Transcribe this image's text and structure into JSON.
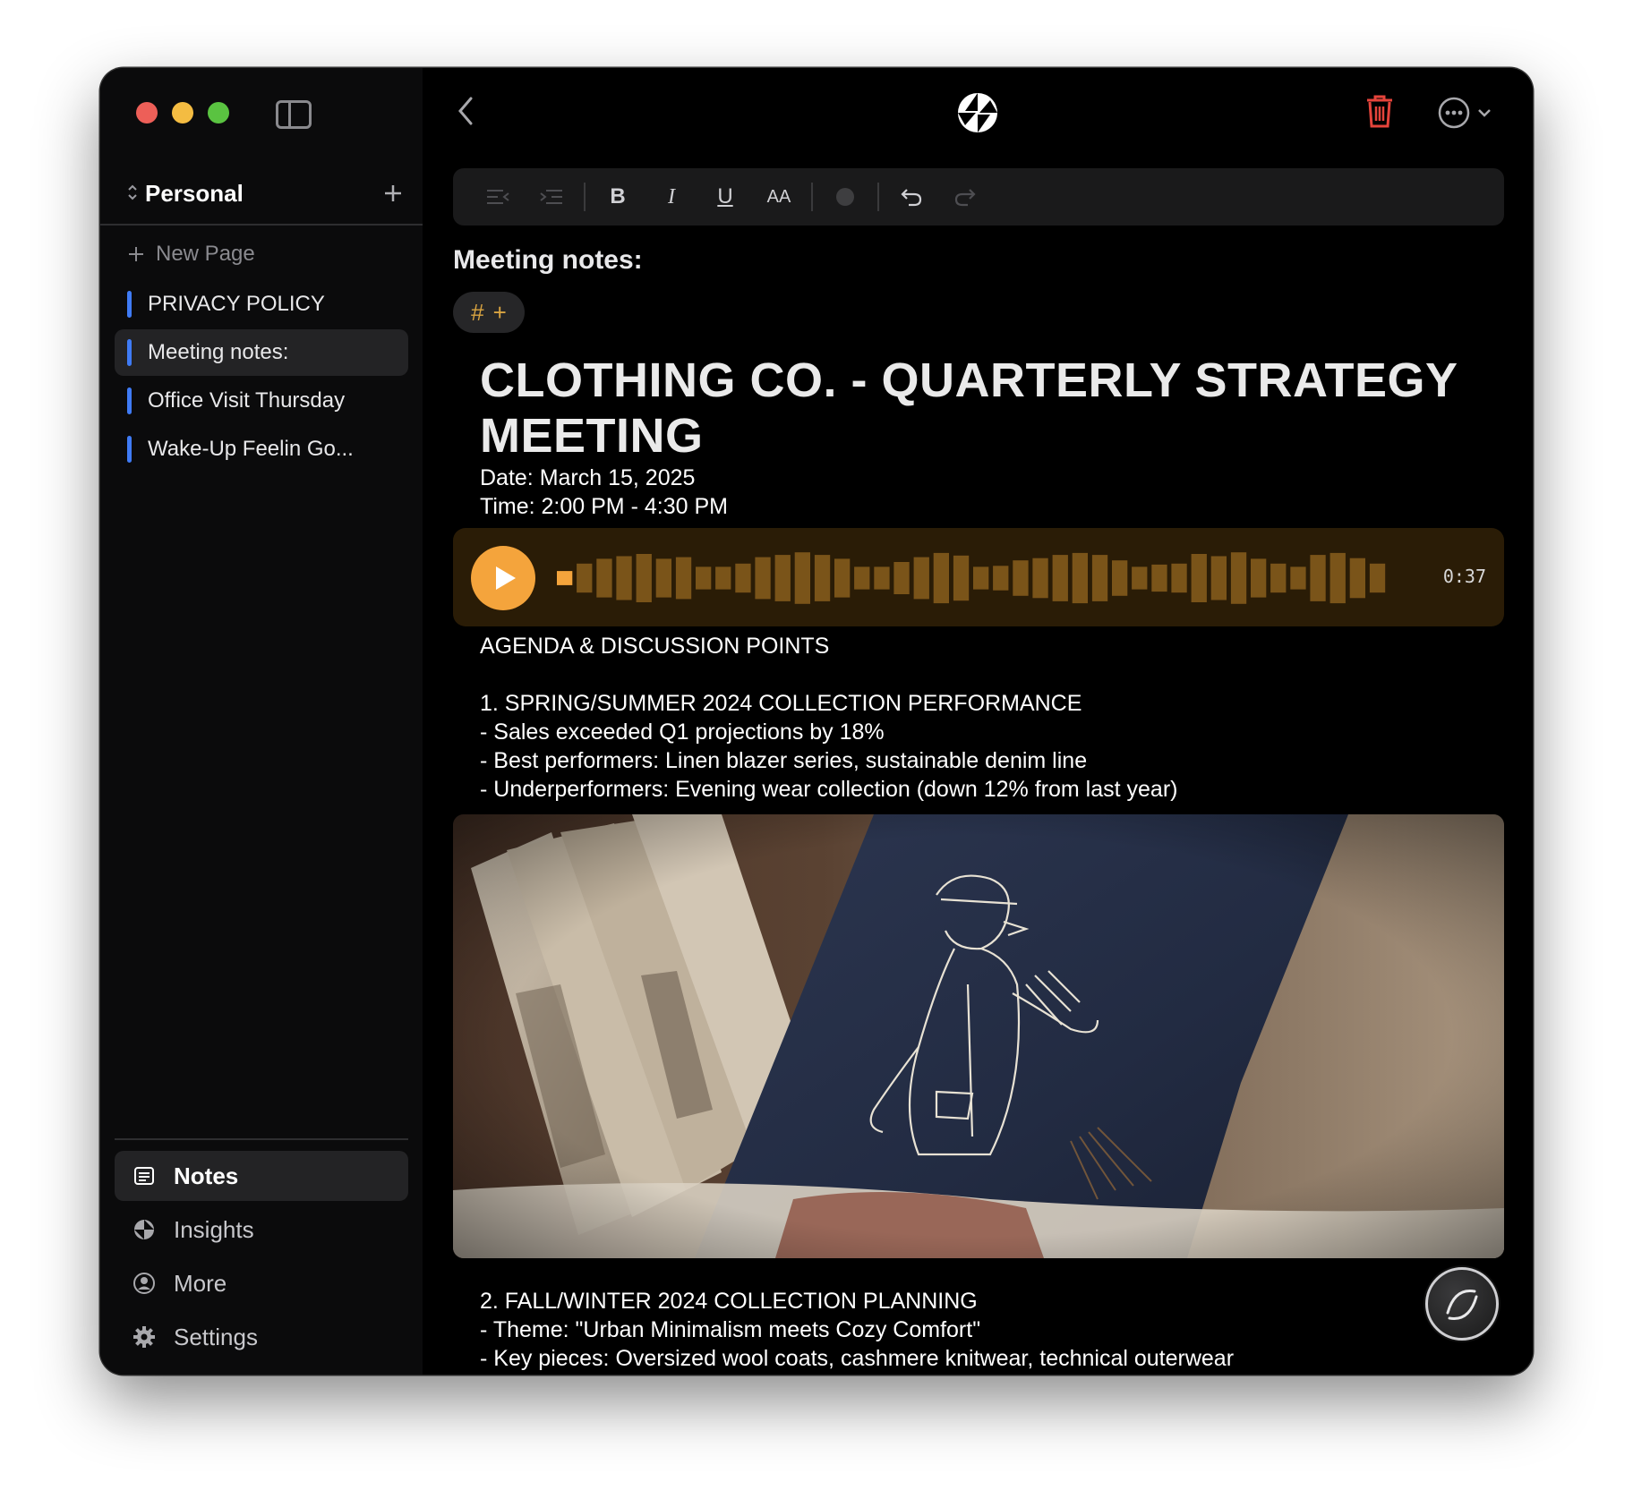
{
  "sidebar": {
    "workspace": "Personal",
    "new_page": "New Page",
    "pages": [
      {
        "label": "PRIVACY POLICY"
      },
      {
        "label": "Meeting notes:"
      },
      {
        "label": "Office Visit Thursday"
      },
      {
        "label": "Wake-Up Feelin Go..."
      }
    ],
    "nav": [
      {
        "label": "Notes",
        "icon": "notes-icon"
      },
      {
        "label": "Insights",
        "icon": "insights-icon"
      },
      {
        "label": "More",
        "icon": "person-icon"
      },
      {
        "label": "Settings",
        "icon": "gear-icon"
      }
    ]
  },
  "toolbar": {
    "bold": "B",
    "italic": "I",
    "underline": "U",
    "text_size": "AA"
  },
  "note": {
    "title": "Meeting notes:",
    "tag_hash": "#",
    "tag_add": "+",
    "heading": "CLOTHING CO. - QUARTERLY STRATEGY MEETING",
    "date": "Date: March 15, 2025",
    "time": "Time: 2:00 PM - 4:30 PM",
    "audio_duration": "0:37",
    "agenda_title": "AGENDA & DISCUSSION POINTS",
    "section1_title": "1. SPRING/SUMMER 2024 COLLECTION PERFORMANCE",
    "section1_lines": [
      "- Sales exceeded Q1 projections by 18%",
      "- Best performers: Linen blazer series, sustainable denim line",
      "- Underperformers: Evening wear collection (down 12% from last year)"
    ],
    "section2_title": "2. FALL/WINTER 2024 COLLECTION PLANNING",
    "section2_lines": [
      "- Theme: \"Urban Minimalism meets Cozy Comfort\"",
      "- Key pieces: Oversized wool coats, cashmere knitwear, technical outerwear"
    ]
  },
  "colors": {
    "accent_orange": "#f4a43c",
    "page_bar_blue": "#3f7bf5",
    "trash_red": "#e5443b"
  }
}
